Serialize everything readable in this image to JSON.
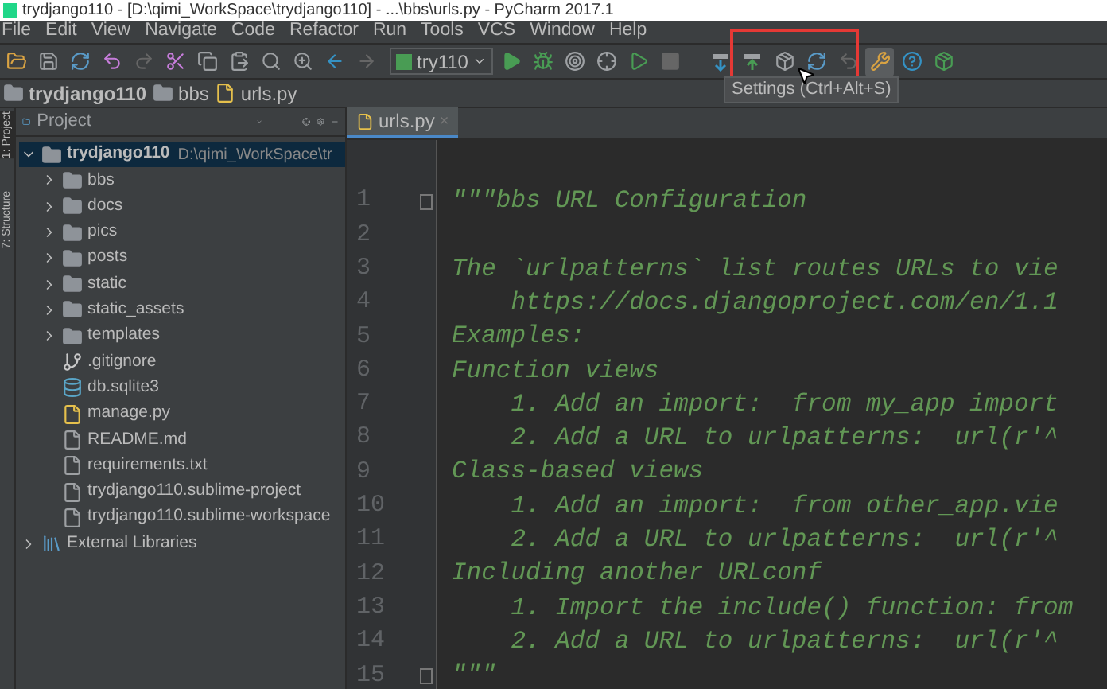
{
  "window": {
    "title": "trydjango110 - [D:\\qimi_WorkSpace\\trydjango110] - ...\\bbs\\urls.py - PyCharm 2017.1"
  },
  "menu": [
    "File",
    "Edit",
    "View",
    "Navigate",
    "Code",
    "Refactor",
    "Run",
    "Tools",
    "VCS",
    "Window",
    "Help"
  ],
  "toolbar": {
    "run_config": "try110",
    "tooltip": "Settings (Ctrl+Alt+S)"
  },
  "breadcrumb": [
    {
      "label": "trydjango110",
      "kind": "root"
    },
    {
      "label": "bbs",
      "kind": "folder"
    },
    {
      "label": "urls.py",
      "kind": "python"
    }
  ],
  "side_tabs": [
    {
      "label": "1: Project",
      "selected": true
    },
    {
      "label": "7: Structure",
      "selected": false
    }
  ],
  "project_panel": {
    "title": "Project",
    "tree": [
      {
        "label": "trydjango110",
        "path": "D:\\qimi_WorkSpace\\tr",
        "kind": "root",
        "expanded": true,
        "selected": true,
        "children": [
          {
            "label": "bbs",
            "kind": "folder",
            "expanded": false,
            "selected": false
          },
          {
            "label": "docs",
            "kind": "folder",
            "expanded": false,
            "selected": false
          },
          {
            "label": "pics",
            "kind": "folder",
            "expanded": false,
            "selected": false
          },
          {
            "label": "posts",
            "kind": "folder",
            "expanded": false,
            "selected": false
          },
          {
            "label": "static",
            "kind": "folder",
            "expanded": false,
            "selected": false
          },
          {
            "label": "static_assets",
            "kind": "folder",
            "expanded": false,
            "selected": false
          },
          {
            "label": "templates",
            "kind": "folder",
            "expanded": false,
            "selected": false
          },
          {
            "label": ".gitignore",
            "kind": "git",
            "selected": false
          },
          {
            "label": "db.sqlite3",
            "kind": "db",
            "selected": false
          },
          {
            "label": "manage.py",
            "kind": "python",
            "selected": false
          },
          {
            "label": "README.md",
            "kind": "file",
            "selected": false
          },
          {
            "label": "requirements.txt",
            "kind": "file",
            "selected": false
          },
          {
            "label": "trydjango110.sublime-project",
            "kind": "file",
            "selected": false
          },
          {
            "label": "trydjango110.sublime-workspace",
            "kind": "file",
            "selected": false
          }
        ]
      },
      {
        "label": "External Libraries",
        "kind": "library",
        "expanded": false,
        "selected": false
      }
    ]
  },
  "editor": {
    "tabs": [
      {
        "label": "urls.py",
        "selected": true,
        "close": "×"
      }
    ],
    "lines": [
      {
        "number": "1",
        "text": "\"\"\"bbs URL Configuration",
        "fold": true
      },
      {
        "number": "2"
      },
      {
        "number": "3",
        "text": "The `urlpatterns` list routes URLs to vie"
      },
      {
        "number": "4",
        "text": "    https://docs.djangoproject.com/en/1.1"
      },
      {
        "number": "5",
        "text": "Examples:"
      },
      {
        "number": "6",
        "text": "Function views"
      },
      {
        "number": "7",
        "text": "    1. Add an import:  from my_app import"
      },
      {
        "number": "8",
        "text": "    2. Add a URL to urlpatterns:  url(r'^"
      },
      {
        "number": "9",
        "text": "Class-based views"
      },
      {
        "number": "10",
        "text": "    1. Add an import:  from other_app.vie"
      },
      {
        "number": "11",
        "text": "    2. Add a URL to urlpatterns:  url(r'^"
      },
      {
        "number": "12",
        "text": "Including another URLconf"
      },
      {
        "number": "13",
        "text": "    1. Import the include() function: from"
      },
      {
        "number": "14",
        "text": "    2. Add a URL to urlpatterns:  url(r'^"
      },
      {
        "number": "15",
        "text": "\"\"\"",
        "fold": true
      }
    ]
  }
}
